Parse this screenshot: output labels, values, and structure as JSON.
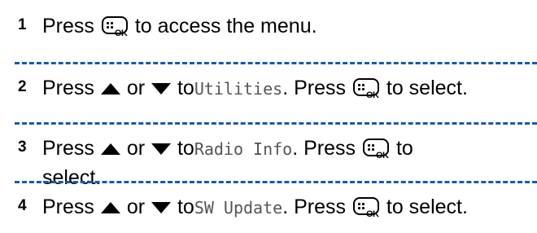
{
  "steps": [
    {
      "number": "1",
      "parts": {
        "a": "Press",
        "b": "to access the menu."
      }
    },
    {
      "number": "2",
      "parts": {
        "a": "Press",
        "b": "or",
        "c": "to",
        "d": "Utilities",
        "e": ". Press",
        "f": "to select."
      }
    },
    {
      "number": "3",
      "parts": {
        "a": "Press",
        "b": "or",
        "c": "to",
        "d": "Radio Info",
        "e": ". Press",
        "f": "to",
        "g": "select."
      }
    },
    {
      "number": "4",
      "parts": {
        "a": "Press",
        "b": "or",
        "c": "to",
        "d": "SW Update",
        "e": ". Press",
        "f": "to select."
      }
    }
  ],
  "icons": {
    "menu_ok_button": "menu-ok-button-icon",
    "up_arrow": "up-arrow-icon",
    "down_arrow": "down-arrow-icon"
  },
  "colors": {
    "divider": "#1a5aa3",
    "menu_item_text": "#555555"
  }
}
